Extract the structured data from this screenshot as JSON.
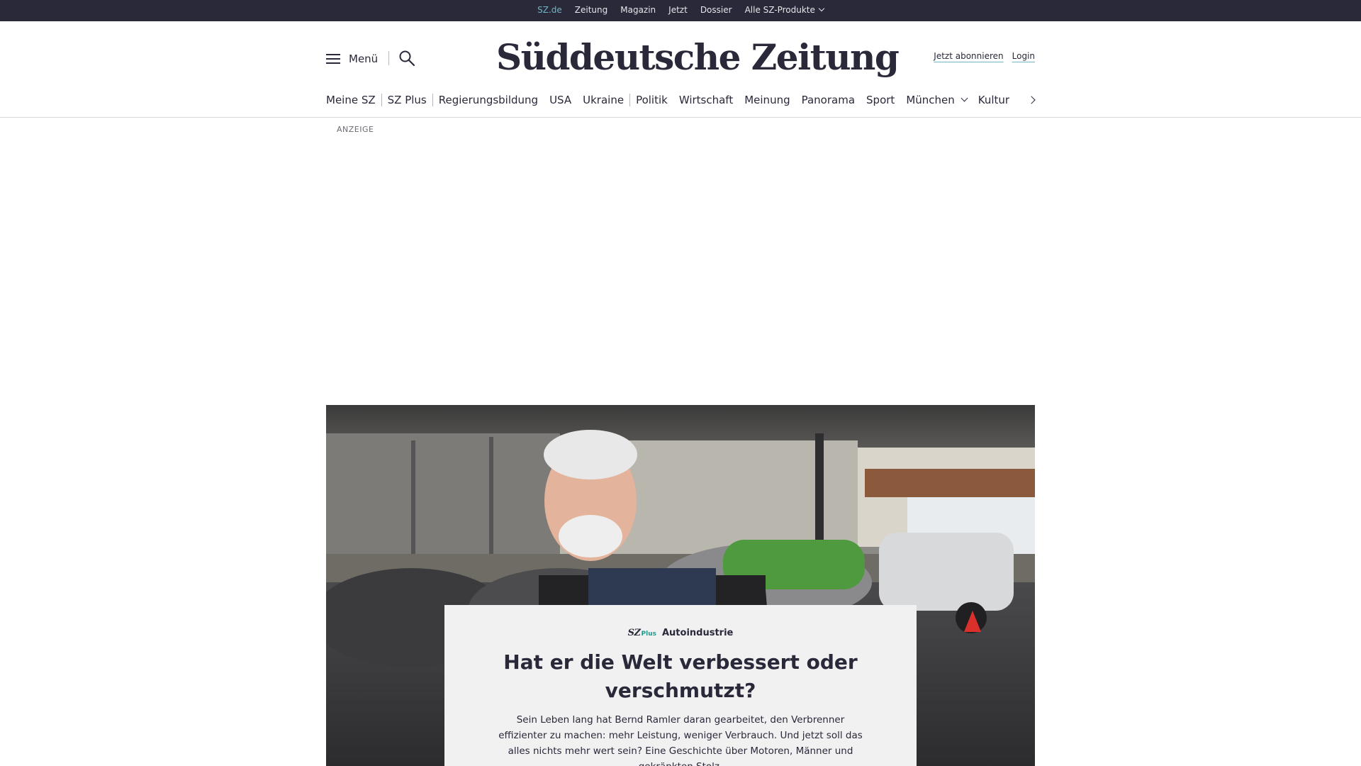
{
  "topbar": {
    "links": [
      "SZ.de",
      "Zeitung",
      "Magazin",
      "Jetzt",
      "Dossier",
      "Alle SZ-Produkte"
    ]
  },
  "header": {
    "menu_label": "Menü",
    "logo_text": "Süddeutsche Zeitung",
    "subscribe_label": "Jetzt abonnieren",
    "login_label": "Login"
  },
  "nav": {
    "items": [
      "Meine SZ",
      "SZ Plus",
      "Regierungsbildung",
      "USA",
      "Ukraine",
      "Politik",
      "Wirtschaft",
      "Meinung",
      "Panorama",
      "Sport",
      "München",
      "Kultur"
    ]
  },
  "ad": {
    "label": "ANZEIGE"
  },
  "teaser": {
    "badge_sz": "SZ",
    "badge_plus": "Plus",
    "kicker": "Autoindustrie",
    "headline": "Hat er die Welt verbessert oder verschmutzt?",
    "text": "Sein Leben lang hat Bernd Ramler daran gearbeitet, den Verbrenner effizienter zu machen: mehr Leistung, weniger Verbrauch. Und jetzt soll das alles nichts mehr wert sein? Eine Geschichte über Motoren, Männer und gekränkten Stolz."
  },
  "colors": {
    "topbar_bg": "#29293a",
    "accent": "#6fb5c2",
    "szplus_green": "#1d9c8e",
    "teaser_bg": "#f1f1f2"
  }
}
